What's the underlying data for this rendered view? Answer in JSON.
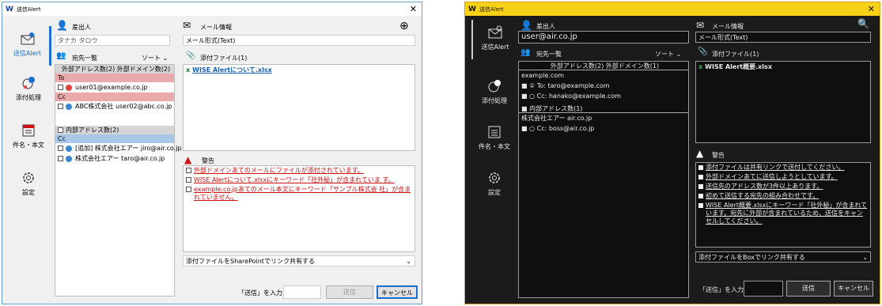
{
  "light": {
    "title": "送信Alert",
    "logo": "W",
    "nav": [
      "送信Alert",
      "添付処理",
      "件名・本文",
      "設定"
    ],
    "sender_label": "差出人",
    "sender_value": "タナカ タロウ",
    "recipients_label": "宛先一覧",
    "sort_label": "ソート",
    "external_header": "外部アドレス数(2) 外部ドメイン数(2)",
    "to_label": "To",
    "to_row": "user01@example.co.jp",
    "cc_label": "Cc",
    "cc_row": "ABC株式会社 user02@abc.co.jp",
    "internal_header": "内部アドレス数(2)",
    "cc2_label": "Cc",
    "int_row1": "[追加] 株式会社エアー jiro@air.co.jp",
    "int_row2": "株式会社エアー taro@air.co.jp",
    "mail_info_label": "メール情報",
    "mail_format": "メール形式(Text)",
    "attach_label": "添付ファイル(1)",
    "attach_file": "WISE Alertについて.xlsx",
    "warning_label": "警告",
    "warnings": [
      "外部ドメインあてのメールにファイルが添付されています。",
      "WISE Alertについて.xlsxにキーワード「社外秘」が含まれていま す。",
      "example.co.jpあてのメール本文にキーワード「サンプル株式会 社」が含まれていません。"
    ],
    "share_option": "添付ファイルをSharePointでリンク共有する",
    "send_prompt": "「送信」を入力",
    "send_btn": "送信",
    "cancel_btn": "キャンセル"
  },
  "dark": {
    "title": "送信Alert",
    "logo": "W",
    "nav": [
      "送信Alert",
      "添付処理",
      "件名・本文",
      "設定"
    ],
    "sender_label": "差出人",
    "sender_value": "user@air.co.jp",
    "recipients_label": "宛先一覧",
    "sort_label": "ソート",
    "external_header": "外部アドレス数(2) 外部ドメイン数(1)",
    "ext_domain": "example.com",
    "ext_row1": "■ ① To: taro@example.com",
    "ext_row2": "■ ○ Cc: hanako@example.com",
    "internal_header": "■ 内部アドレス数(1)",
    "int_company": "株式会社エアー air.co.jp",
    "int_row1": "■ ○ Cc: boss@air.co.jp",
    "mail_info_label": "メール情報",
    "mail_format": "メール形式(Text)",
    "attach_label": "添付ファイル(1)",
    "attach_file": "WISE Alert概要.xlsx",
    "warning_label": "警告",
    "warnings": [
      "添付ファイルは共有リンクで送付してください。",
      "外部ドメインあてに送信しようとしています。",
      "送信先のアドレス数が3件以上あります。",
      "初めて送信する宛先の組み合わせです。",
      "WISE Alert概要.xlsxにキーワード「社外秘」が含まれています。宛先に外部が含まれているため、送信をキャンセルしてください。"
    ],
    "share_option": "添付ファイルをBoxでリンク共有する",
    "send_prompt": "「送信」を入力",
    "send_btn": "送信",
    "cancel_btn": "キャンセル"
  },
  "colors": {
    "red_dot": "#e04040",
    "blue_dot": "#3a86d0",
    "accent": "#1a6fd0",
    "dark_title": "#f7d117"
  }
}
